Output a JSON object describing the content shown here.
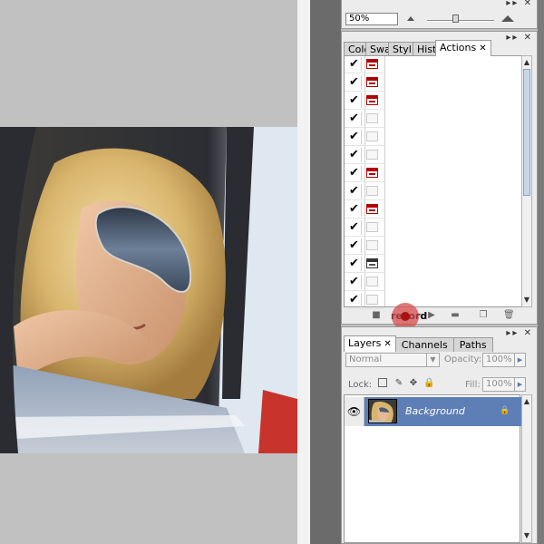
{
  "navigator": {
    "zoom_value": "50%",
    "zoom_out_icon": "small-mountain-icon",
    "zoom_in_icon": "large-mountain-icon",
    "panel_controls": "▸▸ ✕"
  },
  "actions_panel": {
    "panel_controls": "▸▸ ✕",
    "tabs": [
      {
        "label": "Colo"
      },
      {
        "label": "Swa"
      },
      {
        "label": "Styl"
      },
      {
        "label": "Hist"
      },
      {
        "label": "Actions",
        "close": "✕"
      }
    ],
    "rows": [
      {
        "check": "✔",
        "dialog": "red"
      },
      {
        "check": "✔",
        "dialog": "red"
      },
      {
        "check": "✔",
        "dialog": "red"
      },
      {
        "check": "✔",
        "dialog": "none"
      },
      {
        "check": "✔",
        "dialog": "none"
      },
      {
        "check": "✔",
        "dialog": "none"
      },
      {
        "check": "✔",
        "dialog": "red"
      },
      {
        "check": "✔",
        "dialog": "none"
      },
      {
        "check": "✔",
        "dialog": "red"
      },
      {
        "check": "✔",
        "dialog": "none"
      },
      {
        "check": "✔",
        "dialog": "none"
      },
      {
        "check": "✔",
        "dialog": "black"
      },
      {
        "check": "✔",
        "dialog": "none"
      },
      {
        "check": "✔",
        "dialog": "none"
      }
    ],
    "tooltip": "record",
    "toolbar": {
      "stop": "■",
      "play": "▶",
      "new_set": "▬",
      "new_action": "❐",
      "delete": "🗑"
    },
    "scroll_up": "▲",
    "scroll_down": "▼"
  },
  "layers_panel": {
    "panel_controls": "▸▸ ✕",
    "tabs": [
      {
        "label": "Layers",
        "close": "✕",
        "active": true
      },
      {
        "label": "Channels"
      },
      {
        "label": "Paths"
      }
    ],
    "blend_mode": "Normal",
    "opacity_label": "Opacity:",
    "opacity_value": "100%",
    "lock_label": "Lock:",
    "fill_label": "Fill:",
    "fill_value": "100%",
    "layers": [
      {
        "name": "Background",
        "visible_icon": "👁",
        "locked": "🔒"
      }
    ]
  },
  "colors": {
    "selected_layer": "#5d7fb6",
    "record_highlight": "#d64e4e",
    "workspace": "#6b6b6b"
  }
}
